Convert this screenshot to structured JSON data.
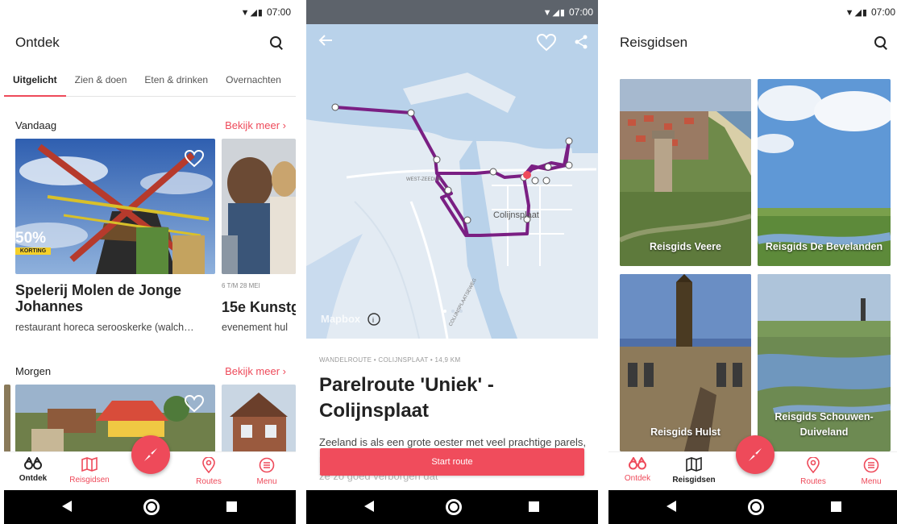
{
  "status": {
    "time": "07:00",
    "icons": "▼◢▮"
  },
  "screen1": {
    "title": "Ontdek",
    "tabs": [
      {
        "label": "Uitgelicht"
      },
      {
        "label": "Zien & doen"
      },
      {
        "label": "Eten & drinken"
      },
      {
        "label": "Overnachten"
      }
    ],
    "today": {
      "heading": "Vandaag",
      "more": "Bekijk meer  ›",
      "card1": {
        "discount": "50%",
        "badge": "KORTING",
        "title": "Spelerij Molen de Jonge Johannes",
        "tags": "restaurant  horeca  serooskerke (walch…"
      },
      "card2": {
        "date": "6 T/M 28 MEI",
        "title": "15e Kunstg",
        "tags": "evenement  hul"
      }
    },
    "tomorrow": {
      "heading": "Morgen",
      "more": "Bekijk meer  ›"
    }
  },
  "nav": {
    "ontdek": "Ontdek",
    "reisgidsen": "Reisgidsen",
    "routes": "Routes",
    "menu": "Menu"
  },
  "screen2": {
    "map_labels": {
      "town": "Colijnsplaat",
      "street1": "WEST-ZEEDIJK",
      "street2": "COLIJNSPLAATSEWEG",
      "brand": "Mapbox"
    },
    "meta": "WANDELROUTE • COLIJNSPLAAT • 14,9 KM",
    "title": "Parelroute 'Uniek' - Colijnsplaat",
    "body": "Zeeland is als een grote oester met veel prachtige parels, maar sommige zijn goed verborgen schatten. Soms zijn ze zo goed verborgen dat",
    "start": "Start route"
  },
  "screen3": {
    "title": "Reisgidsen",
    "guides": [
      {
        "label": "Reisgids Veere"
      },
      {
        "label": "Reisgids De Bevelanden"
      },
      {
        "label": "Reisgids Hulst"
      },
      {
        "label": "Reisgids Schouwen-Duiveland"
      }
    ]
  },
  "colors": {
    "accent": "#ee4a5a",
    "route": "#7a1f83",
    "badge": "#f5d02a"
  }
}
